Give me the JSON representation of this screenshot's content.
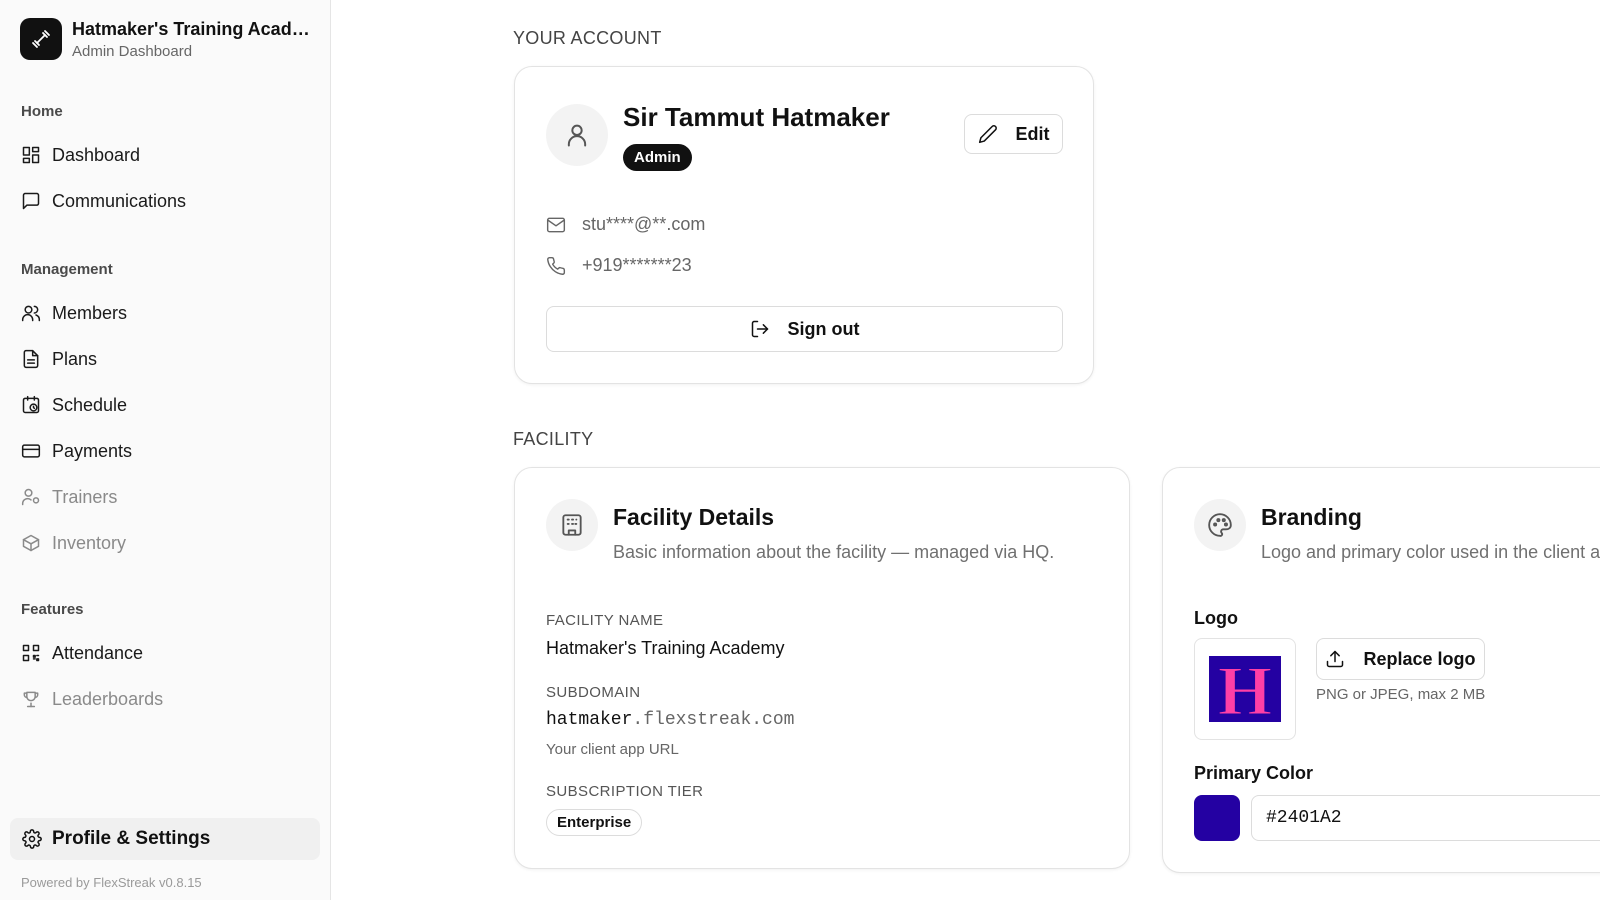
{
  "sidebar": {
    "brand_title": "Hatmaker's Training Academy",
    "brand_sub": "Admin Dashboard",
    "sections": {
      "home": "Home",
      "management": "Management",
      "features": "Features"
    },
    "items": {
      "dashboard": "Dashboard",
      "communications": "Communications",
      "members": "Members",
      "plans": "Plans",
      "schedule": "Schedule",
      "payments": "Payments",
      "trainers": "Trainers",
      "inventory": "Inventory",
      "attendance": "Attendance",
      "leaderboards": "Leaderboards"
    },
    "active_item": "Profile & Settings",
    "powered_by": "Powered by FlexStreak v0.8.15"
  },
  "account": {
    "section_label": "YOUR ACCOUNT",
    "name": "Sir Tammut Hatmaker",
    "role_badge": "Admin",
    "edit_label": "Edit",
    "email": "stu****@**.com",
    "phone": "+919*******23",
    "sign_out_label": "Sign out"
  },
  "facility": {
    "section_label": "FACILITY",
    "details": {
      "title": "Facility Details",
      "description": "Basic information about the facility — managed via HQ.",
      "name_label": "FACILITY NAME",
      "name_value": "Hatmaker's Training Academy",
      "subdomain_label": "SUBDOMAIN",
      "subdomain_prefix": "hatmaker",
      "subdomain_suffix": ".flexstreak.com",
      "subdomain_hint": "Your client app URL",
      "tier_label": "SUBSCRIPTION TIER",
      "tier_value": "Enterprise"
    },
    "branding": {
      "title": "Branding",
      "description": "Logo and primary color used in the client a",
      "logo_label": "Logo",
      "logo_letter": "H",
      "replace_logo_label": "Replace logo",
      "logo_hint": "PNG or JPEG, max 2 MB",
      "primary_color_label": "Primary Color",
      "primary_color_value": "#2401A2"
    }
  },
  "colors": {
    "primary": "#2401A2",
    "logo_bg": "#2401A2",
    "logo_letter": "#ff3fa6"
  }
}
